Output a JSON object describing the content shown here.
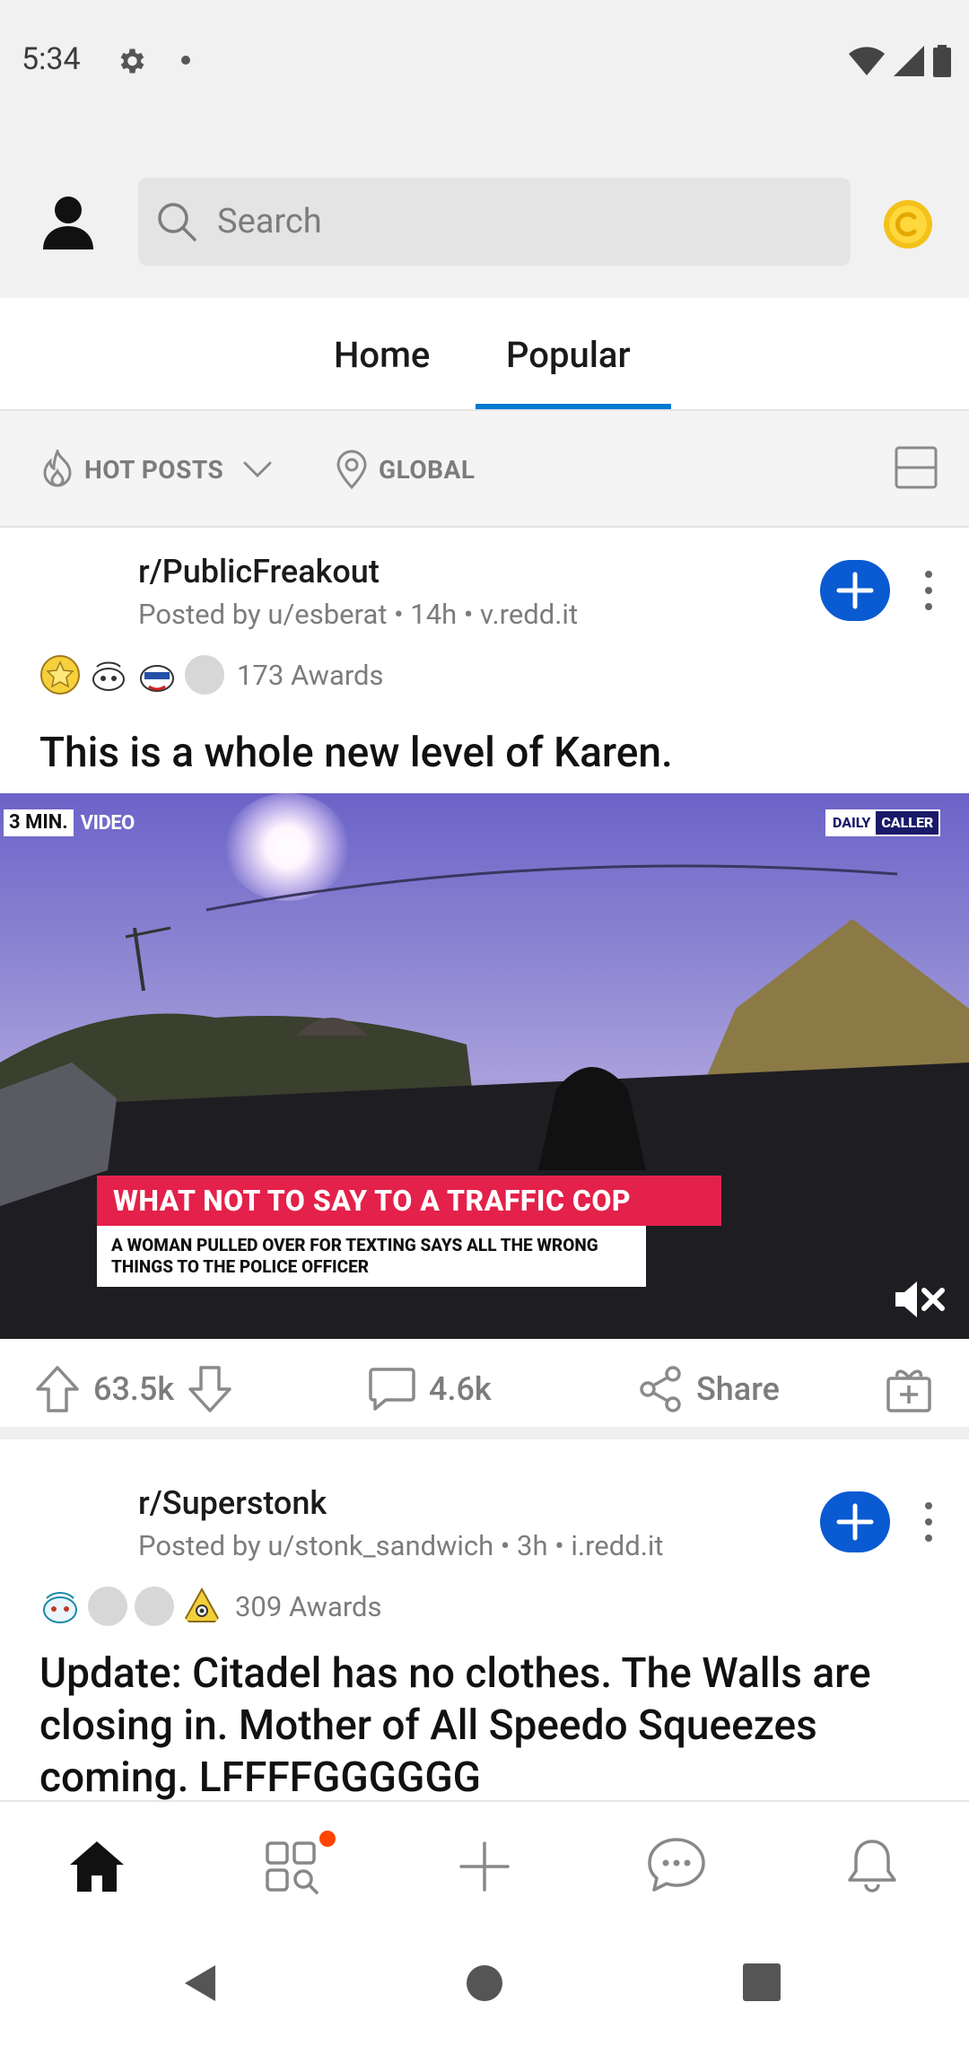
{
  "status_bar": {
    "time": "5:34"
  },
  "header": {
    "search_placeholder": "Search"
  },
  "tabs": [
    {
      "label": "Home"
    },
    {
      "label": "Popular"
    }
  ],
  "filter_bar": {
    "sort_label": "HOT POSTS",
    "location_label": "GLOBAL"
  },
  "posts": [
    {
      "subreddit": "r/PublicFreakout",
      "meta": "Posted by u/esberat • 14h • v.redd.it",
      "awards_count": "173 Awards",
      "title": "This is a whole new level of Karen.",
      "video": {
        "badge_left": "3 MIN.",
        "badge_right": "VIDEO",
        "logo_left": "DAILY",
        "logo_right": "CALLER",
        "caption_headline": "WHAT NOT TO SAY TO A TRAFFIC COP",
        "caption_sub": "A WOMAN PULLED OVER FOR TEXTING SAYS ALL THE WRONG THINGS TO THE POLICE OFFICER"
      },
      "upvotes": "63.5k",
      "comments": "4.6k",
      "share_label": "Share"
    },
    {
      "subreddit": "r/Superstonk",
      "meta": "Posted by u/stonk_sandwich • 3h • i.redd.it",
      "awards_count": "309 Awards",
      "title": "Update: Citadel has no clothes. The Walls are closing in. Mother of All Speedo Squeezes coming. LFFFFGGGGGG"
    }
  ],
  "colors": {
    "accent": "#0079d3",
    "join_button": "#0a5ad2",
    "notification_dot": "#ff4500"
  }
}
